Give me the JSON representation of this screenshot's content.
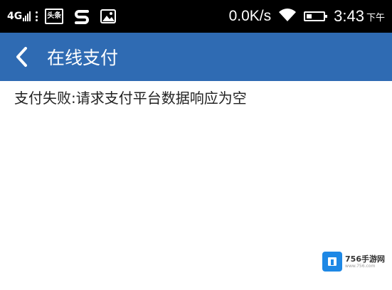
{
  "status_bar": {
    "network_type": "4G",
    "toutiao_label": "头条",
    "net_speed": "0.0K/s",
    "battery_level": 0.3,
    "time": "3:43",
    "am_pm": "下午",
    "icons": [
      "signal-icon",
      "more-dots-icon",
      "toutiao-icon",
      "s-app-icon",
      "image-icon",
      "wifi-icon",
      "battery-icon"
    ]
  },
  "title_bar": {
    "title": "在线支付",
    "accent_color": "#2f6bb3",
    "back_icon": "chevron-left-icon"
  },
  "content": {
    "message": "支付失败:请求支付平台数据响应为空"
  },
  "watermark": {
    "name": "756手游网",
    "url": "www.756.com"
  }
}
